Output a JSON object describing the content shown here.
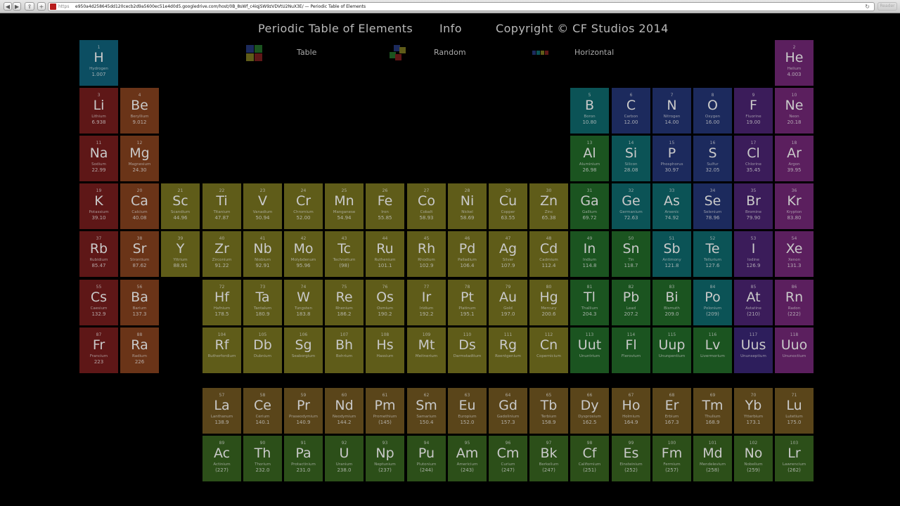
{
  "browser": {
    "scheme": "https",
    "url": "e950a4d258645dd120cecb2d9a5600ec51e4d0d5.googledrive.com/host/0B_8sWf_c4iqjSW9zVDVtU2NuX3E/ — Periodic Table of Elements",
    "reader_label": "Reader"
  },
  "header": {
    "title": "Periodic Table of Elements",
    "info": "Info",
    "copyright": "Copyright © CF Studios 2014"
  },
  "views": [
    {
      "label": "Table"
    },
    {
      "label": "Random"
    },
    {
      "label": "Horizontal"
    }
  ],
  "colors": {
    "nonmetal": "#0d5a60",
    "noble": "#5b1f5e",
    "alkali": "#5e1717",
    "alkaline": "#6a3418",
    "transition": "#5f5c19",
    "posttrans": "#1b5420",
    "metalloid": "#0b5356",
    "halogen": "#3b1c5a",
    "lanthanide": "#5a451a",
    "actinide": "#2c4f19",
    "hydrogen": "#0c4e62",
    "other_nonmetal": "#1c2a5d",
    "unknown": "#2d1e5c"
  },
  "elements": [
    {
      "n": "1",
      "s": "H",
      "name": "Hydrogen",
      "w": "1.007",
      "col": 1,
      "row": 1,
      "t": "hydrogen"
    },
    {
      "n": "2",
      "s": "He",
      "name": "Helium",
      "w": "4.003",
      "col": 18,
      "row": 1,
      "t": "noble"
    },
    {
      "n": "3",
      "s": "Li",
      "name": "Lithium",
      "w": "6.938",
      "col": 1,
      "row": 2,
      "t": "alkali"
    },
    {
      "n": "4",
      "s": "Be",
      "name": "Beryllium",
      "w": "9.012",
      "col": 2,
      "row": 2,
      "t": "alkaline"
    },
    {
      "n": "5",
      "s": "B",
      "name": "Boron",
      "w": "10.80",
      "col": 13,
      "row": 2,
      "t": "metalloid"
    },
    {
      "n": "6",
      "s": "C",
      "name": "Carbon",
      "w": "12.00",
      "col": 14,
      "row": 2,
      "t": "other_nonmetal"
    },
    {
      "n": "7",
      "s": "N",
      "name": "Nitrogen",
      "w": "14.00",
      "col": 15,
      "row": 2,
      "t": "other_nonmetal"
    },
    {
      "n": "8",
      "s": "O",
      "name": "Oxygen",
      "w": "16.00",
      "col": 16,
      "row": 2,
      "t": "other_nonmetal"
    },
    {
      "n": "9",
      "s": "F",
      "name": "Fluorine",
      "w": "19.00",
      "col": 17,
      "row": 2,
      "t": "halogen"
    },
    {
      "n": "10",
      "s": "Ne",
      "name": "Neon",
      "w": "20.18",
      "col": 18,
      "row": 2,
      "t": "noble"
    },
    {
      "n": "11",
      "s": "Na",
      "name": "Sodium",
      "w": "22.99",
      "col": 1,
      "row": 3,
      "t": "alkali"
    },
    {
      "n": "12",
      "s": "Mg",
      "name": "Magnesium",
      "w": "24.30",
      "col": 2,
      "row": 3,
      "t": "alkaline"
    },
    {
      "n": "13",
      "s": "Al",
      "name": "Aluminium",
      "w": "26.98",
      "col": 13,
      "row": 3,
      "t": "posttrans"
    },
    {
      "n": "14",
      "s": "Si",
      "name": "Silicon",
      "w": "28.08",
      "col": 14,
      "row": 3,
      "t": "metalloid"
    },
    {
      "n": "15",
      "s": "P",
      "name": "Phosphorus",
      "w": "30.97",
      "col": 15,
      "row": 3,
      "t": "other_nonmetal"
    },
    {
      "n": "16",
      "s": "S",
      "name": "Sulfur",
      "w": "32.05",
      "col": 16,
      "row": 3,
      "t": "other_nonmetal"
    },
    {
      "n": "17",
      "s": "Cl",
      "name": "Chlorine",
      "w": "35.45",
      "col": 17,
      "row": 3,
      "t": "halogen"
    },
    {
      "n": "18",
      "s": "Ar",
      "name": "Argon",
      "w": "39.95",
      "col": 18,
      "row": 3,
      "t": "noble"
    },
    {
      "n": "19",
      "s": "K",
      "name": "Potassium",
      "w": "39.10",
      "col": 1,
      "row": 4,
      "t": "alkali"
    },
    {
      "n": "20",
      "s": "Ca",
      "name": "Calcium",
      "w": "40.08",
      "col": 2,
      "row": 4,
      "t": "alkaline"
    },
    {
      "n": "21",
      "s": "Sc",
      "name": "Scandium",
      "w": "44.96",
      "col": 3,
      "row": 4,
      "t": "transition"
    },
    {
      "n": "22",
      "s": "Ti",
      "name": "Titanium",
      "w": "47.87",
      "col": 4,
      "row": 4,
      "t": "transition"
    },
    {
      "n": "23",
      "s": "V",
      "name": "Vanadium",
      "w": "50.94",
      "col": 5,
      "row": 4,
      "t": "transition"
    },
    {
      "n": "24",
      "s": "Cr",
      "name": "Chromium",
      "w": "52.00",
      "col": 6,
      "row": 4,
      "t": "transition"
    },
    {
      "n": "25",
      "s": "Mn",
      "name": "Manganese",
      "w": "54.94",
      "col": 7,
      "row": 4,
      "t": "transition"
    },
    {
      "n": "26",
      "s": "Fe",
      "name": "Iron",
      "w": "55.85",
      "col": 8,
      "row": 4,
      "t": "transition"
    },
    {
      "n": "27",
      "s": "Co",
      "name": "Cobalt",
      "w": "58.93",
      "col": 9,
      "row": 4,
      "t": "transition"
    },
    {
      "n": "28",
      "s": "Ni",
      "name": "Nickel",
      "w": "58.69",
      "col": 10,
      "row": 4,
      "t": "transition"
    },
    {
      "n": "29",
      "s": "Cu",
      "name": "Copper",
      "w": "63.55",
      "col": 11,
      "row": 4,
      "t": "transition"
    },
    {
      "n": "30",
      "s": "Zn",
      "name": "Zinc",
      "w": "65.38",
      "col": 12,
      "row": 4,
      "t": "transition"
    },
    {
      "n": "31",
      "s": "Ga",
      "name": "Gallium",
      "w": "69.72",
      "col": 13,
      "row": 4,
      "t": "posttrans"
    },
    {
      "n": "32",
      "s": "Ge",
      "name": "Germanium",
      "w": "72.63",
      "col": 14,
      "row": 4,
      "t": "metalloid"
    },
    {
      "n": "33",
      "s": "As",
      "name": "Arsenic",
      "w": "74.92",
      "col": 15,
      "row": 4,
      "t": "metalloid"
    },
    {
      "n": "34",
      "s": "Se",
      "name": "Selenium",
      "w": "78.96",
      "col": 16,
      "row": 4,
      "t": "other_nonmetal"
    },
    {
      "n": "35",
      "s": "Br",
      "name": "Bromine",
      "w": "79.90",
      "col": 17,
      "row": 4,
      "t": "halogen"
    },
    {
      "n": "36",
      "s": "Kr",
      "name": "Krypton",
      "w": "83.80",
      "col": 18,
      "row": 4,
      "t": "noble"
    },
    {
      "n": "37",
      "s": "Rb",
      "name": "Rubidium",
      "w": "85.47",
      "col": 1,
      "row": 5,
      "t": "alkali"
    },
    {
      "n": "38",
      "s": "Sr",
      "name": "Strontium",
      "w": "87.62",
      "col": 2,
      "row": 5,
      "t": "alkaline"
    },
    {
      "n": "39",
      "s": "Y",
      "name": "Yttrium",
      "w": "88.91",
      "col": 3,
      "row": 5,
      "t": "transition"
    },
    {
      "n": "40",
      "s": "Zr",
      "name": "Zirconium",
      "w": "91.22",
      "col": 4,
      "row": 5,
      "t": "transition"
    },
    {
      "n": "41",
      "s": "Nb",
      "name": "Niobium",
      "w": "92.91",
      "col": 5,
      "row": 5,
      "t": "transition"
    },
    {
      "n": "42",
      "s": "Mo",
      "name": "Molybdenum",
      "w": "95.96",
      "col": 6,
      "row": 5,
      "t": "transition"
    },
    {
      "n": "43",
      "s": "Tc",
      "name": "Technetium",
      "w": "(98)",
      "col": 7,
      "row": 5,
      "t": "transition"
    },
    {
      "n": "44",
      "s": "Ru",
      "name": "Ruthenium",
      "w": "101.1",
      "col": 8,
      "row": 5,
      "t": "transition"
    },
    {
      "n": "45",
      "s": "Rh",
      "name": "Rhodium",
      "w": "102.9",
      "col": 9,
      "row": 5,
      "t": "transition"
    },
    {
      "n": "46",
      "s": "Pd",
      "name": "Palladium",
      "w": "106.4",
      "col": 10,
      "row": 5,
      "t": "transition"
    },
    {
      "n": "47",
      "s": "Ag",
      "name": "Silver",
      "w": "107.9",
      "col": 11,
      "row": 5,
      "t": "transition"
    },
    {
      "n": "48",
      "s": "Cd",
      "name": "Cadmium",
      "w": "112.4",
      "col": 12,
      "row": 5,
      "t": "transition"
    },
    {
      "n": "49",
      "s": "In",
      "name": "Indium",
      "w": "114.8",
      "col": 13,
      "row": 5,
      "t": "posttrans"
    },
    {
      "n": "50",
      "s": "Sn",
      "name": "Tin",
      "w": "118.7",
      "col": 14,
      "row": 5,
      "t": "posttrans"
    },
    {
      "n": "51",
      "s": "Sb",
      "name": "Antimony",
      "w": "121.8",
      "col": 15,
      "row": 5,
      "t": "metalloid"
    },
    {
      "n": "52",
      "s": "Te",
      "name": "Tellurium",
      "w": "127.6",
      "col": 16,
      "row": 5,
      "t": "metalloid"
    },
    {
      "n": "53",
      "s": "I",
      "name": "Iodine",
      "w": "126.9",
      "col": 17,
      "row": 5,
      "t": "halogen"
    },
    {
      "n": "54",
      "s": "Xe",
      "name": "Xenon",
      "w": "131.3",
      "col": 18,
      "row": 5,
      "t": "noble"
    },
    {
      "n": "55",
      "s": "Cs",
      "name": "Caesium",
      "w": "132.9",
      "col": 1,
      "row": 6,
      "t": "alkali"
    },
    {
      "n": "56",
      "s": "Ba",
      "name": "Barium",
      "w": "137.3",
      "col": 2,
      "row": 6,
      "t": "alkaline"
    },
    {
      "n": "72",
      "s": "Hf",
      "name": "Hafnium",
      "w": "178.5",
      "col": 4,
      "row": 6,
      "t": "transition"
    },
    {
      "n": "73",
      "s": "Ta",
      "name": "Tantalum",
      "w": "180.9",
      "col": 5,
      "row": 6,
      "t": "transition"
    },
    {
      "n": "74",
      "s": "W",
      "name": "Tungsten",
      "w": "183.8",
      "col": 6,
      "row": 6,
      "t": "transition"
    },
    {
      "n": "75",
      "s": "Re",
      "name": "Rhenium",
      "w": "186.2",
      "col": 7,
      "row": 6,
      "t": "transition"
    },
    {
      "n": "76",
      "s": "Os",
      "name": "Osmium",
      "w": "190.2",
      "col": 8,
      "row": 6,
      "t": "transition"
    },
    {
      "n": "77",
      "s": "Ir",
      "name": "Iridium",
      "w": "192.2",
      "col": 9,
      "row": 6,
      "t": "transition"
    },
    {
      "n": "78",
      "s": "Pt",
      "name": "Platinum",
      "w": "195.1",
      "col": 10,
      "row": 6,
      "t": "transition"
    },
    {
      "n": "79",
      "s": "Au",
      "name": "Gold",
      "w": "197.0",
      "col": 11,
      "row": 6,
      "t": "transition"
    },
    {
      "n": "80",
      "s": "Hg",
      "name": "Mercury",
      "w": "200.6",
      "col": 12,
      "row": 6,
      "t": "transition"
    },
    {
      "n": "81",
      "s": "Tl",
      "name": "Thallium",
      "w": "204.3",
      "col": 13,
      "row": 6,
      "t": "posttrans"
    },
    {
      "n": "82",
      "s": "Pb",
      "name": "Lead",
      "w": "207.2",
      "col": 14,
      "row": 6,
      "t": "posttrans"
    },
    {
      "n": "83",
      "s": "Bi",
      "name": "Bismuth",
      "w": "209.0",
      "col": 15,
      "row": 6,
      "t": "posttrans"
    },
    {
      "n": "84",
      "s": "Po",
      "name": "Polonium",
      "w": "(209)",
      "col": 16,
      "row": 6,
      "t": "metalloid"
    },
    {
      "n": "85",
      "s": "At",
      "name": "Astatine",
      "w": "(210)",
      "col": 17,
      "row": 6,
      "t": "halogen"
    },
    {
      "n": "86",
      "s": "Rn",
      "name": "Radon",
      "w": "(222)",
      "col": 18,
      "row": 6,
      "t": "noble"
    },
    {
      "n": "87",
      "s": "Fr",
      "name": "Francium",
      "w": "223",
      "col": 1,
      "row": 7,
      "t": "alkali"
    },
    {
      "n": "88",
      "s": "Ra",
      "name": "Radium",
      "w": "226",
      "col": 2,
      "row": 7,
      "t": "alkaline"
    },
    {
      "n": "104",
      "s": "Rf",
      "name": "Rutherfordium",
      "w": "",
      "col": 4,
      "row": 7,
      "t": "transition"
    },
    {
      "n": "105",
      "s": "Db",
      "name": "Dubnium",
      "w": "",
      "col": 5,
      "row": 7,
      "t": "transition"
    },
    {
      "n": "106",
      "s": "Sg",
      "name": "Seaborgium",
      "w": "",
      "col": 6,
      "row": 7,
      "t": "transition"
    },
    {
      "n": "107",
      "s": "Bh",
      "name": "Bohrium",
      "w": "",
      "col": 7,
      "row": 7,
      "t": "transition"
    },
    {
      "n": "108",
      "s": "Hs",
      "name": "Hassium",
      "w": "",
      "col": 8,
      "row": 7,
      "t": "transition"
    },
    {
      "n": "109",
      "s": "Mt",
      "name": "Meitnerium",
      "w": "",
      "col": 9,
      "row": 7,
      "t": "transition"
    },
    {
      "n": "110",
      "s": "Ds",
      "name": "Darmstadtium",
      "w": "",
      "col": 10,
      "row": 7,
      "t": "transition"
    },
    {
      "n": "111",
      "s": "Rg",
      "name": "Roentgenium",
      "w": "",
      "col": 11,
      "row": 7,
      "t": "transition"
    },
    {
      "n": "112",
      "s": "Cn",
      "name": "Copernicium",
      "w": "",
      "col": 12,
      "row": 7,
      "t": "transition"
    },
    {
      "n": "113",
      "s": "Uut",
      "name": "Ununtrium",
      "w": "",
      "col": 13,
      "row": 7,
      "t": "posttrans"
    },
    {
      "n": "114",
      "s": "Fl",
      "name": "Flerovium",
      "w": "",
      "col": 14,
      "row": 7,
      "t": "posttrans"
    },
    {
      "n": "115",
      "s": "Uup",
      "name": "Ununpentium",
      "w": "",
      "col": 15,
      "row": 7,
      "t": "posttrans"
    },
    {
      "n": "116",
      "s": "Lv",
      "name": "Livermorium",
      "w": "",
      "col": 16,
      "row": 7,
      "t": "posttrans"
    },
    {
      "n": "117",
      "s": "Uus",
      "name": "Ununseptium",
      "w": "",
      "col": 17,
      "row": 7,
      "t": "unknown"
    },
    {
      "n": "118",
      "s": "Uuo",
      "name": "Ununoctium",
      "w": "",
      "col": 18,
      "row": 7,
      "t": "noble"
    },
    {
      "n": "57",
      "s": "La",
      "name": "Lanthanum",
      "w": "138.9",
      "col": 4,
      "row": 9,
      "t": "lanthanide"
    },
    {
      "n": "58",
      "s": "Ce",
      "name": "Cerium",
      "w": "140.1",
      "col": 5,
      "row": 9,
      "t": "lanthanide"
    },
    {
      "n": "59",
      "s": "Pr",
      "name": "Praseodymium",
      "w": "140.9",
      "col": 6,
      "row": 9,
      "t": "lanthanide"
    },
    {
      "n": "60",
      "s": "Nd",
      "name": "Neodymium",
      "w": "144.2",
      "col": 7,
      "row": 9,
      "t": "lanthanide"
    },
    {
      "n": "61",
      "s": "Pm",
      "name": "Promethium",
      "w": "(145)",
      "col": 8,
      "row": 9,
      "t": "lanthanide"
    },
    {
      "n": "62",
      "s": "Sm",
      "name": "Samarium",
      "w": "150.4",
      "col": 9,
      "row": 9,
      "t": "lanthanide"
    },
    {
      "n": "63",
      "s": "Eu",
      "name": "Europium",
      "w": "152.0",
      "col": 10,
      "row": 9,
      "t": "lanthanide"
    },
    {
      "n": "64",
      "s": "Gd",
      "name": "Gadolinium",
      "w": "157.3",
      "col": 11,
      "row": 9,
      "t": "lanthanide"
    },
    {
      "n": "65",
      "s": "Tb",
      "name": "Terbium",
      "w": "158.9",
      "col": 12,
      "row": 9,
      "t": "lanthanide"
    },
    {
      "n": "66",
      "s": "Dy",
      "name": "Dysprosium",
      "w": "162.5",
      "col": 13,
      "row": 9,
      "t": "lanthanide"
    },
    {
      "n": "67",
      "s": "Ho",
      "name": "Holmium",
      "w": "164.9",
      "col": 14,
      "row": 9,
      "t": "lanthanide"
    },
    {
      "n": "68",
      "s": "Er",
      "name": "Erbium",
      "w": "167.3",
      "col": 15,
      "row": 9,
      "t": "lanthanide"
    },
    {
      "n": "69",
      "s": "Tm",
      "name": "Thulium",
      "w": "168.9",
      "col": 16,
      "row": 9,
      "t": "lanthanide"
    },
    {
      "n": "70",
      "s": "Yb",
      "name": "Ytterbium",
      "w": "173.1",
      "col": 17,
      "row": 9,
      "t": "lanthanide"
    },
    {
      "n": "71",
      "s": "Lu",
      "name": "Lutetium",
      "w": "175.0",
      "col": 18,
      "row": 9,
      "t": "lanthanide"
    },
    {
      "n": "89",
      "s": "Ac",
      "name": "Actinium",
      "w": "(227)",
      "col": 4,
      "row": 10,
      "t": "actinide"
    },
    {
      "n": "90",
      "s": "Th",
      "name": "Thorium",
      "w": "232.0",
      "col": 5,
      "row": 10,
      "t": "actinide"
    },
    {
      "n": "91",
      "s": "Pa",
      "name": "Protactinium",
      "w": "231.0",
      "col": 6,
      "row": 10,
      "t": "actinide"
    },
    {
      "n": "92",
      "s": "U",
      "name": "Uranium",
      "w": "238.0",
      "col": 7,
      "row": 10,
      "t": "actinide"
    },
    {
      "n": "93",
      "s": "Np",
      "name": "Neptunium",
      "w": "(237)",
      "col": 8,
      "row": 10,
      "t": "actinide"
    },
    {
      "n": "94",
      "s": "Pu",
      "name": "Plutonium",
      "w": "(244)",
      "col": 9,
      "row": 10,
      "t": "actinide"
    },
    {
      "n": "95",
      "s": "Am",
      "name": "Americium",
      "w": "(243)",
      "col": 10,
      "row": 10,
      "t": "actinide"
    },
    {
      "n": "96",
      "s": "Cm",
      "name": "Curium",
      "w": "(247)",
      "col": 11,
      "row": 10,
      "t": "actinide"
    },
    {
      "n": "97",
      "s": "Bk",
      "name": "Berkelium",
      "w": "(247)",
      "col": 12,
      "row": 10,
      "t": "actinide"
    },
    {
      "n": "98",
      "s": "Cf",
      "name": "Californium",
      "w": "(251)",
      "col": 13,
      "row": 10,
      "t": "actinide"
    },
    {
      "n": "99",
      "s": "Es",
      "name": "Einsteinium",
      "w": "(252)",
      "col": 14,
      "row": 10,
      "t": "actinide"
    },
    {
      "n": "100",
      "s": "Fm",
      "name": "Fermium",
      "w": "(257)",
      "col": 15,
      "row": 10,
      "t": "actinide"
    },
    {
      "n": "101",
      "s": "Md",
      "name": "Mendelevium",
      "w": "(258)",
      "col": 16,
      "row": 10,
      "t": "actinide"
    },
    {
      "n": "102",
      "s": "No",
      "name": "Nobelium",
      "w": "(259)",
      "col": 17,
      "row": 10,
      "t": "actinide"
    },
    {
      "n": "103",
      "s": "Lr",
      "name": "Lawrencium",
      "w": "(262)",
      "col": 18,
      "row": 10,
      "t": "actinide"
    }
  ]
}
